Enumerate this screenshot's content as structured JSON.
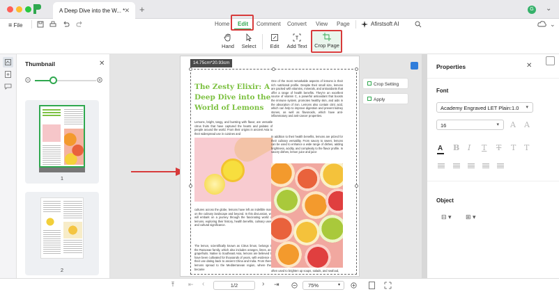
{
  "window": {
    "tab_title": "A Deep Dive into the W...",
    "tab_modified": "*",
    "new_tab": "+",
    "avatar_initial": "G"
  },
  "toolbar": {
    "file_label": "File",
    "tabs": [
      "Home",
      "Edit",
      "Comment",
      "Convert",
      "View",
      "Page"
    ],
    "active_tab": "Edit",
    "ai_label": "Afirstsoft AI",
    "tools": [
      {
        "label": "Hand",
        "icon": "hand-icon"
      },
      {
        "label": "Select",
        "icon": "cursor-icon"
      },
      {
        "label": "Edit",
        "icon": "edit-text-icon"
      },
      {
        "label": "Add Text",
        "icon": "add-text-icon"
      },
      {
        "label": "Crop Page",
        "icon": "crop-icon"
      }
    ]
  },
  "thumbnail_panel": {
    "title": "Thumbnail",
    "zoom_fraction": 0.3,
    "pages": [
      "1",
      "2"
    ]
  },
  "document": {
    "dimension_badge": "14.75cm*20.93cm",
    "heading": "The Zesty Elixir: A Deep Dive into the World of Lemons",
    "col1_para1": "Lemons, bright, tangy, and bursting with flavor, are versatile citrus fruits that have captured the hearts and palates of people around the world. From their origins in ancient Asia to their widespread use in cuisines and",
    "col1_para2": "cultures across the globe, lemons have left an indelible mark on the culinary landscape and beyond. In this discussion, we will embark on a journey through the fascinating world of lemons, exploring their history, health benefits, culinary uses, and cultural significance.",
    "col1_para3": "The lemon, scientifically known as Citrus limon, belongs to the Rutaceae family, which also includes oranges, limes, and grapefruits. Native to Southeast Asia, lemons are believed to have been cultivated for thousands of years, with evidence of their use dating back to ancient China and India. From there, lemons spread to the Mediterranean region, where they became",
    "col2_para1": "One of the most remarkable aspects of lemons is their rich nutritional profile. Despite their small size, lemons are packed with vitamins, minerals, and antioxidants that offer a range of health benefits. They're an excellent source of vitamin C, a powerful antioxidant that boosts the immune system, promotes healthy skin, and aids in the absorption of iron. Lemons also contain citric acid, which can help to improve digestion and prevent kidney stones, as well as flavonoids, which have anti-inflammatory and anti-cancer properties.",
    "col2_para2": "In addition to their health benefits, lemons are prized for their culinary versatility. From savory to sweet, lemons can be used to enhance a wide range of dishes, adding brightness, acidity, and complexity to the flavor profile. In savory dishes, lemon juice and juice",
    "col2_footer": "often used to brighten up soups, salads, and seafood,"
  },
  "crop_popover": {
    "setting_label": "Crop Setting",
    "apply_label": "Apply"
  },
  "properties": {
    "title": "Properties",
    "font_section": "Font",
    "font_family": "Academy Engraved LET Plain:1.0",
    "font_size": "16",
    "object_section": "Object"
  },
  "bottom_bar": {
    "page_indicator": "1/2",
    "zoom_level": "75%"
  },
  "colors": {
    "accent_green": "#2fa84f",
    "highlight_red": "#d73a3a",
    "heading_green": "#7dc142"
  }
}
